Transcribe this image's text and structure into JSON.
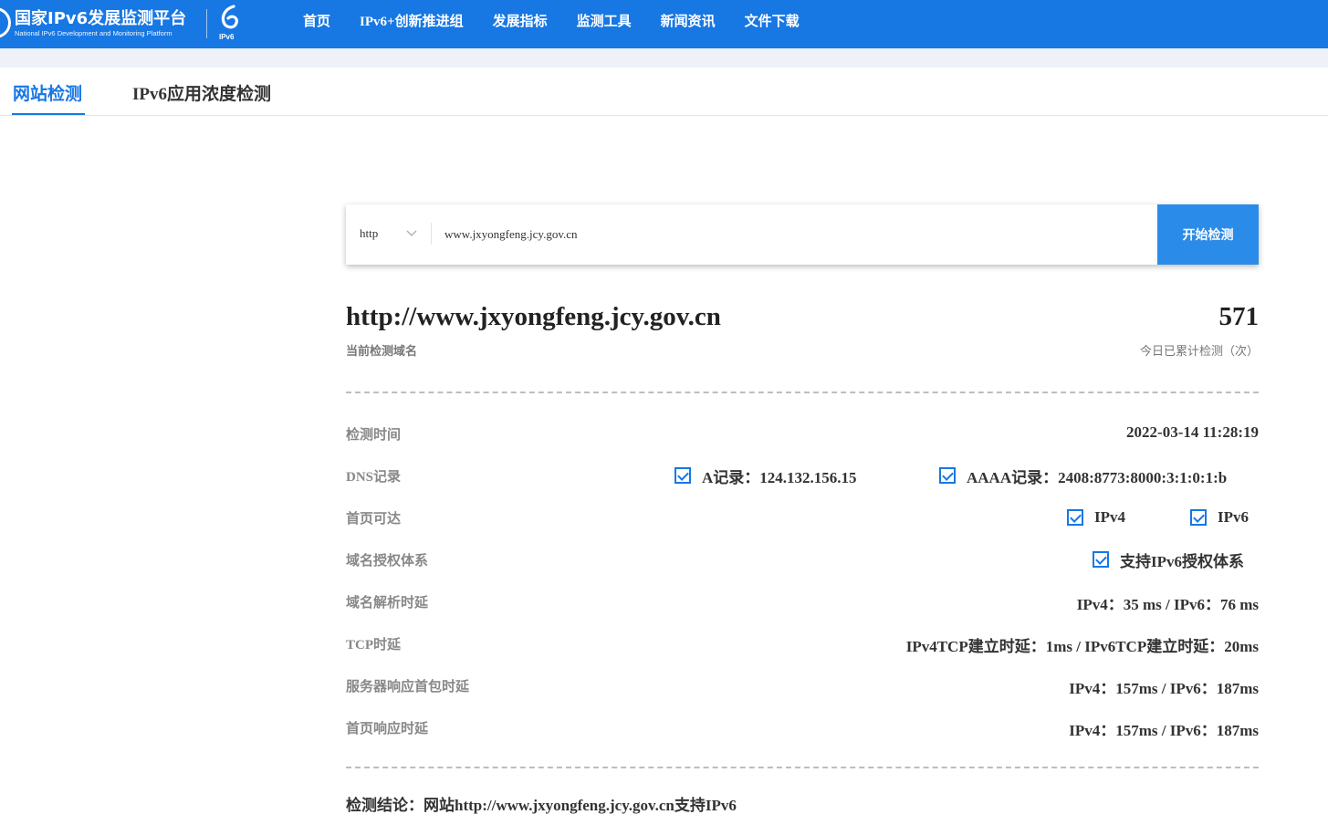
{
  "header": {
    "logo_cn": "国家IPv6发展监测平台",
    "logo_en": "National IPv6 Development and Monitoring Platform",
    "badge_text": "IPv6",
    "nav": [
      "首页",
      "IPv6+创新推进组",
      "发展指标",
      "监测工具",
      "新闻资讯",
      "文件下载"
    ]
  },
  "tabs": [
    "网站检测",
    "IPv6应用浓度检测"
  ],
  "search": {
    "protocol": "http",
    "url_value": "www.jxyongfeng.jcy.gov.cn",
    "button": "开始检测"
  },
  "result": {
    "domain": "http://www.jxyongfeng.jcy.gov.cn",
    "domain_caption": "当前检测域名",
    "count": "571",
    "count_caption": "今日已累计检测（次）",
    "rows": {
      "check_time": {
        "label": "检测时间",
        "value": "2022-03-14 11:28:19"
      },
      "dns": {
        "label": "DNS记录",
        "a": "A记录：124.132.156.15",
        "aaaa": "AAAA记录：2408:8773:8000:3:1:0:1:b"
      },
      "reach": {
        "label": "首页可达",
        "ipv4": "IPv4",
        "ipv6": "IPv6"
      },
      "auth": {
        "label": "域名授权体系",
        "value": "支持IPv6授权体系"
      },
      "dns_delay": {
        "label": "域名解析时延",
        "value": "IPv4：35 ms / IPv6：76 ms"
      },
      "tcp": {
        "label": "TCP时延",
        "value": "IPv4TCP建立时延：1ms / IPv6TCP建立时延：20ms"
      },
      "first_pkt": {
        "label": "服务器响应首包时延",
        "value": "IPv4：157ms / IPv6：187ms"
      },
      "home_resp": {
        "label": "首页响应时延",
        "value": "IPv4：157ms / IPv6：187ms"
      }
    },
    "conclusion": "检测结论：网站http://www.jxyongfeng.jcy.gov.cn支持IPv6"
  },
  "colors": {
    "brand": "#1777e3",
    "button": "#2b8be8"
  }
}
